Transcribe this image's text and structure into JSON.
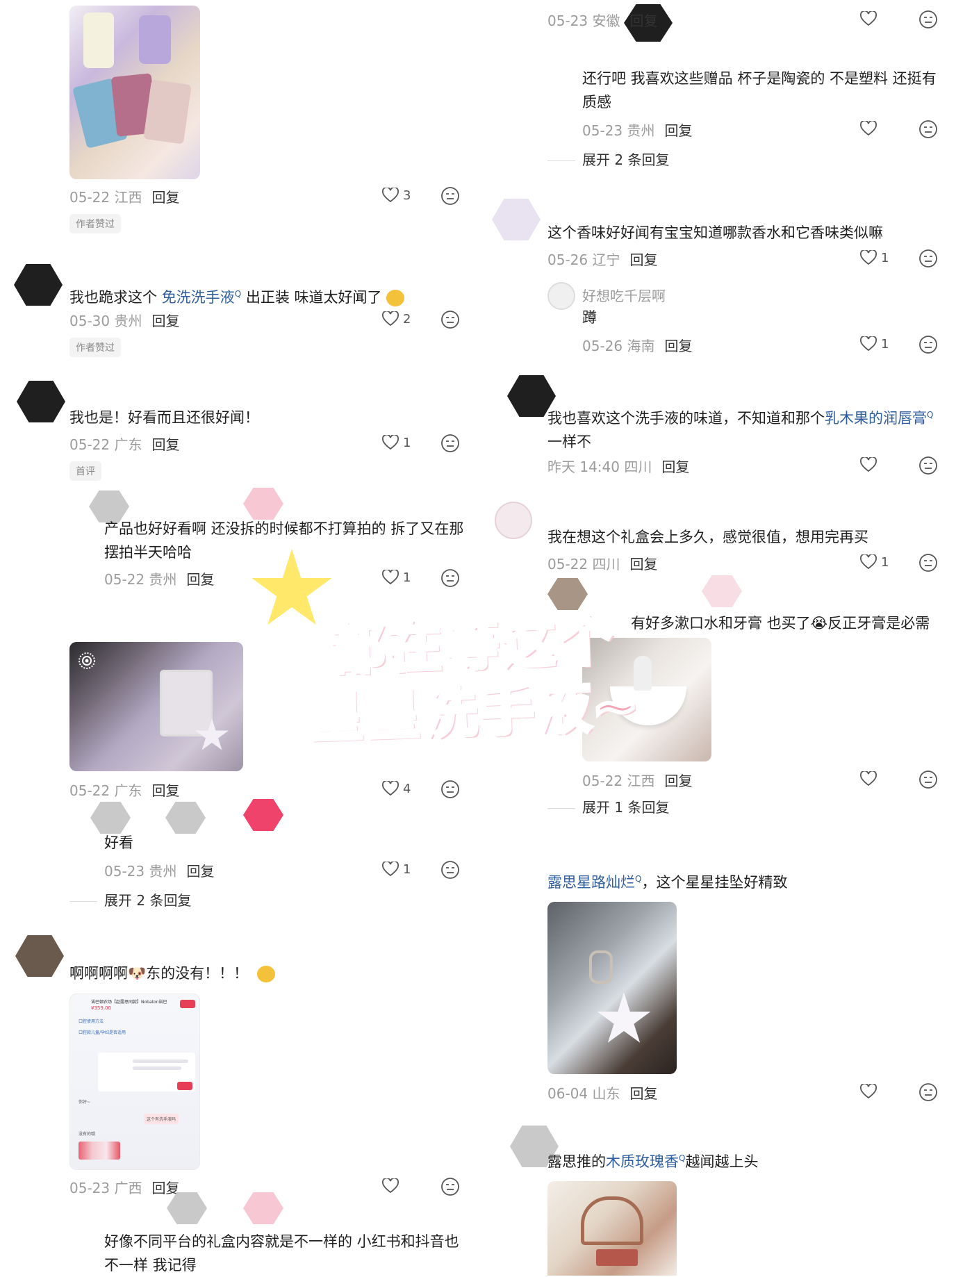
{
  "left": {
    "comments": [
      {
        "date": "05-22 江西",
        "reply": "回复",
        "likes": "3",
        "badge": "作者赞过"
      },
      {
        "text_before": "我也跪求这个",
        "link": "免洗洗手液",
        "text_after": "出正装  味道太好闻了",
        "date": "05-30 贵州",
        "reply": "回复",
        "likes": "2",
        "badge": "作者赞过"
      },
      {
        "text": "我也是！好看而且还很好闻！",
        "date": "05-22 广东",
        "reply": "回复",
        "likes": "1",
        "badge": "首评"
      },
      {
        "text": "产品也好好看啊 还没拆的时候都不打算拍的 拆了又在那摆拍半天哈哈",
        "date": "05-22 贵州",
        "reply": "回复",
        "likes": "1"
      },
      {
        "date": "05-22 广东",
        "reply": "回复",
        "likes": "4"
      },
      {
        "text": "好看",
        "date": "05-23 贵州",
        "reply": "回复",
        "likes": "1",
        "expand": "展开 2 条回复"
      },
      {
        "text": "啊啊啊啊🐶东的没有！！！",
        "date": "05-23 广西",
        "reply": "回复"
      },
      {
        "text": "好像不同平台的礼盒内容就是不一样的 小红书和抖音也不一样 我记得"
      }
    ]
  },
  "right": {
    "comments": [
      {
        "date": "05-23 安徽",
        "reply": "回复"
      },
      {
        "text": "还行吧 我喜欢这些赠品 杯子是陶瓷的 不是塑料 还挺有质感",
        "date": "05-23 贵州",
        "reply": "回复",
        "expand": "展开 2 条回复"
      },
      {
        "text": "这个香味好好闻有宝宝知道哪款香水和它香味类似嘛",
        "date": "05-26 辽宁",
        "reply": "回复",
        "likes": "1"
      },
      {
        "name": "好想吃千层啊",
        "text": "蹲",
        "date": "05-26 海南",
        "reply": "回复",
        "likes": "1"
      },
      {
        "text_before": "我也喜欢这个洗手液的味道，不知道和那个",
        "link": "乳木果的润唇膏",
        "text_after": "一样不",
        "date": "昨天 14:40 四川",
        "reply": "回复"
      },
      {
        "text": "我在想这个礼盒会上多久，感觉很值，想用完再买",
        "date": "05-22 四川",
        "reply": "回复",
        "likes": "1"
      },
      {
        "text": "有好多漱口水和牙膏 也买了😭反正牙膏是必需",
        "date": "05-22 江西",
        "reply": "回复",
        "expand": "展开 1 条回复"
      },
      {
        "link": "露思星路灿烂",
        "text_after": "，这个星星挂坠好精致",
        "date": "06-04 山东",
        "reply": "回复"
      },
      {
        "text_before": "露思推的",
        "link": "木质玫瑰香",
        "text_after": "越闻越上头"
      }
    ]
  },
  "overlay": {
    "line1": "都在等这个",
    "line2": "星星洗手液~"
  },
  "chat_screenshot": {
    "title": "诺巴顿农场【赵露思同款】Nobaton诺巴...",
    "price": "¥359.00",
    "item1": "口腔使用方法",
    "item2": "口腔款儿童/孕妇是否适用",
    "msg1": "你好~",
    "msg2": "这个有洗手液吗",
    "msg3": "没有的哦"
  }
}
